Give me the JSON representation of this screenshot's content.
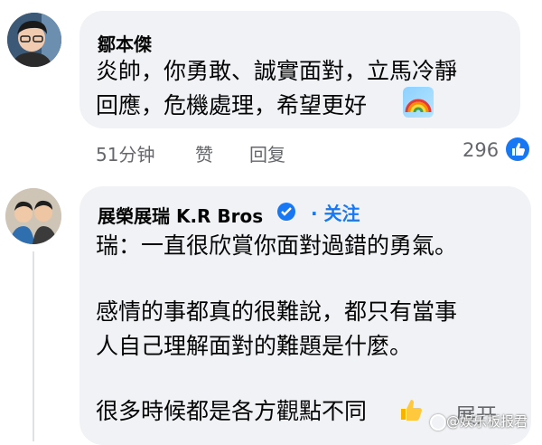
{
  "comment1": {
    "author": "鄒本傑",
    "text_line1": "炎帥，你勇敢、誠實面對，立馬冷靜",
    "text_line2": "回應，危機處理，希望更好",
    "time": "51分钟",
    "like_action": "赞",
    "reply_action": "回复",
    "reaction_count": "296"
  },
  "comment2": {
    "author": "展榮展瑞 K.R Bros",
    "follow_label": "· 关注",
    "line1": "瑞：一直很欣賞你面對過錯的勇氣。",
    "line2": "感情的事都真的很難說，都只有當事",
    "line3": "人自己理解面對的難題是什麼。",
    "line4": "很多時候都是各方觀點不同",
    "expand_label": "展开"
  },
  "watermark": "@娱乐板报君",
  "colors": {
    "bubble": "#f0f2f5",
    "accent": "#1877f2",
    "meta_text": "#65676b"
  }
}
